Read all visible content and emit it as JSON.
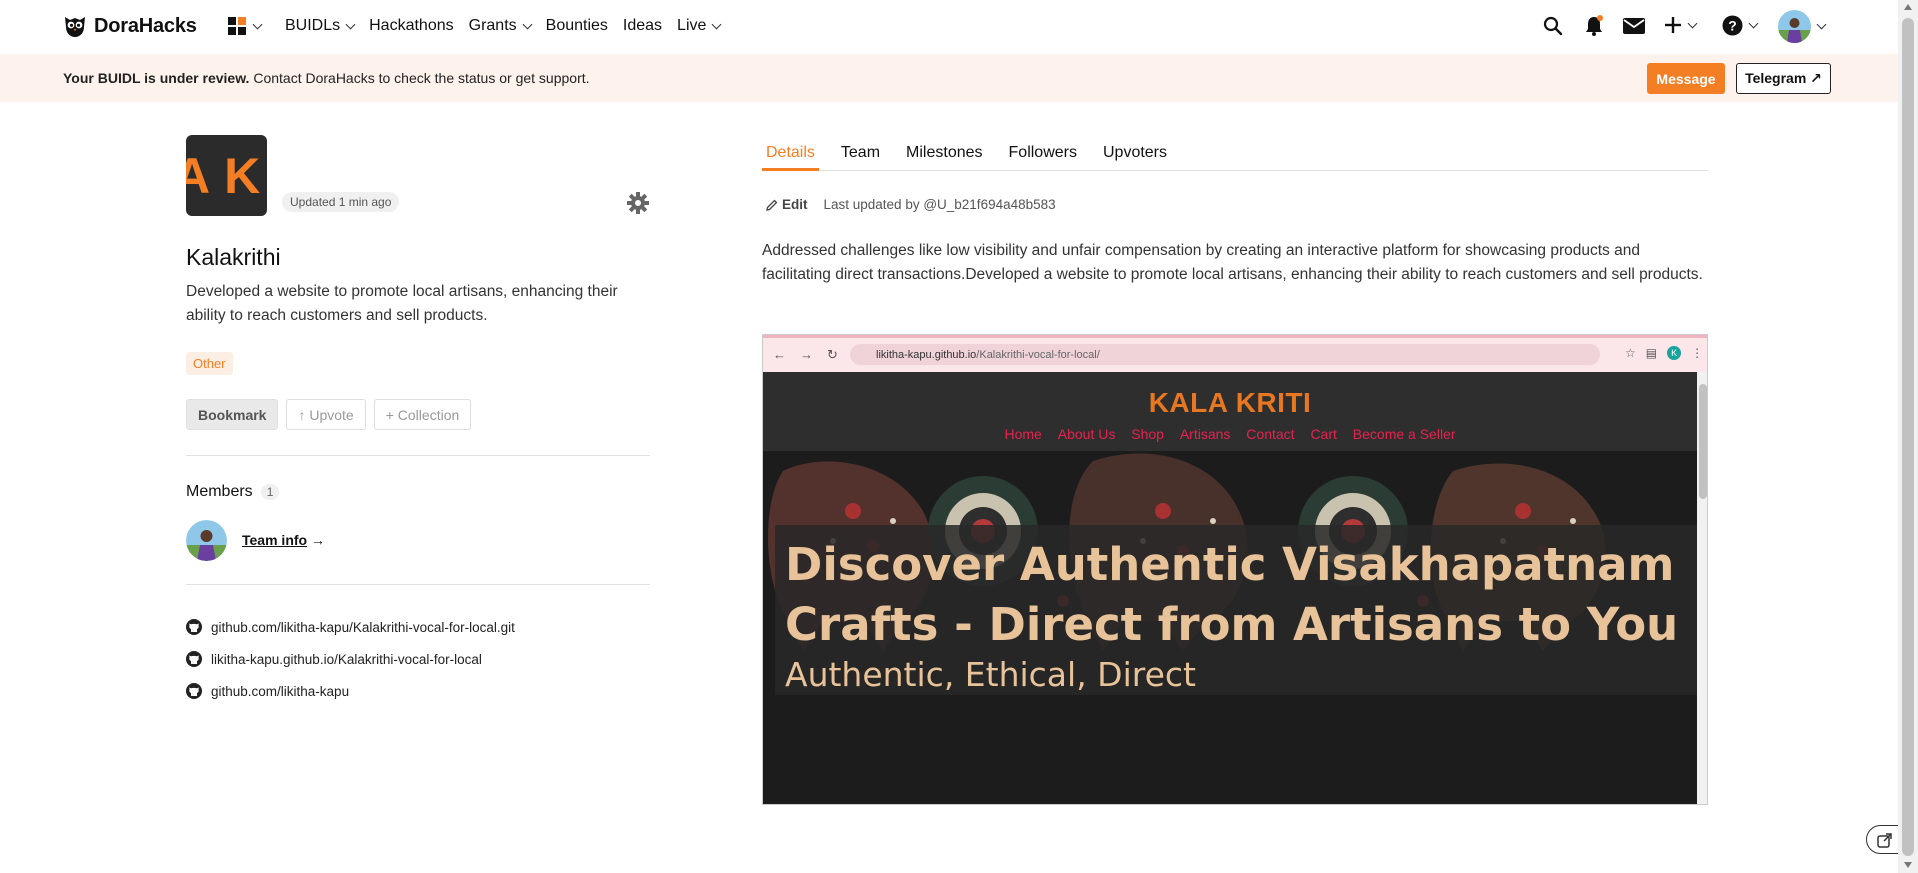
{
  "brand": {
    "name": "DoraHacks",
    "accent": "#f47e23"
  },
  "nav": {
    "items": [
      {
        "label": "BUIDLs",
        "has_menu": true
      },
      {
        "label": "Hackathons",
        "has_menu": false
      },
      {
        "label": "Grants",
        "has_menu": true
      },
      {
        "label": "Bounties",
        "has_menu": false
      },
      {
        "label": "Ideas",
        "has_menu": false
      },
      {
        "label": "Live",
        "has_menu": true
      }
    ],
    "icons": [
      "apps-grid-icon",
      "search-icon",
      "bell-icon",
      "mail-icon",
      "plus-icon",
      "help-icon",
      "avatar"
    ]
  },
  "notice": {
    "bold": "Your BUIDL is under review.",
    "text": " Contact DoraHacks to check the status or get support.",
    "message_button": "Message",
    "telegram_button": "Telegram ↗"
  },
  "project": {
    "logo_text": "A K",
    "updated": "Updated 1 min ago",
    "title": "Kalakrithi",
    "description": "Developed a website to promote local artisans, enhancing their ability to reach customers and sell products.",
    "tag": "Other",
    "actions": {
      "bookmark": "Bookmark",
      "upvote": "↑ Upvote",
      "collection": "+ Collection"
    },
    "members_label": "Members",
    "members_count": "1",
    "team_info": "Team info",
    "team_info_arrow": "→",
    "links": [
      "github.com/likitha-kapu/Kalakrithi-vocal-for-local.git",
      "likitha-kapu.github.io/Kalakrithi-vocal-for-local",
      "github.com/likitha-kapu"
    ]
  },
  "tabs": [
    "Details",
    "Team",
    "Milestones",
    "Followers",
    "Upvoters"
  ],
  "details": {
    "edit_label": "Edit",
    "last_updated": "Last updated by @U_b21f694a48b583",
    "body": "Addressed challenges like low visibility and unfair compensation by creating an interactive platform for showcasing products and facilitating direct transactions.Developed a website to promote local artisans, enhancing their ability to reach customers and sell products."
  },
  "screenshot": {
    "url_host": "likitha-kapu.github.io",
    "url_path": "/Kalakrithi-vocal-for-local/",
    "profile_initial": "K",
    "site_title": "KALA KRITI",
    "site_menu": [
      "Home",
      "About Us",
      "Shop",
      "Artisans",
      "Contact",
      "Cart",
      "Become a Seller"
    ],
    "hero_line1": "Discover Authentic Visakhapatnam",
    "hero_line2": "Crafts - Direct from Artisans to You",
    "hero_sub": "Authentic, Ethical, Direct"
  }
}
